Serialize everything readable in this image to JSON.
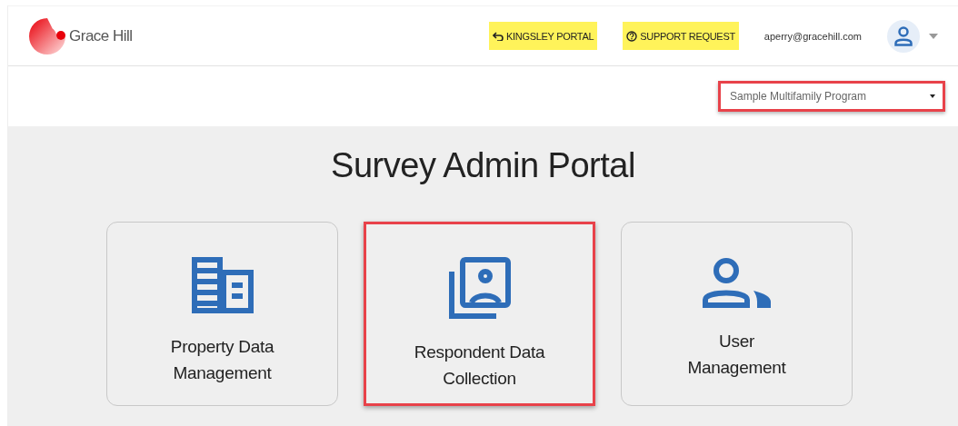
{
  "header": {
    "logo_text": "Grace Hill",
    "links": [
      {
        "kind": "back",
        "label": "KINGSLEY PORTAL",
        "highlighted": true
      },
      {
        "kind": "help",
        "label": "SUPPORT REQUEST",
        "highlighted": true
      }
    ],
    "user_email": "aperry@gracehill.com"
  },
  "program_select": {
    "value": "Sample Multifamily Program",
    "highlighted": true
  },
  "title": "Survey Admin Portal",
  "cards": [
    {
      "kind": "building",
      "line1": "Property Data",
      "line2": "Management",
      "highlighted": false
    },
    {
      "kind": "photos",
      "line1": "Respondent Data",
      "line2": "Collection",
      "highlighted": true
    },
    {
      "kind": "users",
      "line1": "User",
      "line2": "Management",
      "highlighted": false
    }
  ]
}
